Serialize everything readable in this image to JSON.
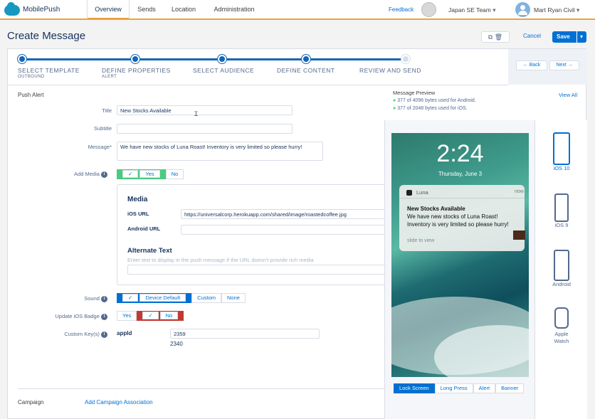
{
  "app": {
    "name": "MobilePush"
  },
  "nav": {
    "tabs": [
      "Overview",
      "Sends",
      "Location",
      "Administration"
    ],
    "feedback": "Feedback",
    "team": "Japan SE Team",
    "user": "Mart Ryan Civil"
  },
  "header": {
    "title": "Create Message",
    "cancel": "Cancel",
    "save": "Save"
  },
  "stepper": {
    "steps": [
      {
        "label": "SELECT TEMPLATE",
        "sub": "OUTBOUND"
      },
      {
        "label": "DEFINE PROPERTIES",
        "sub": "ALERT"
      },
      {
        "label": "SELECT AUDIENCE",
        "sub": ""
      },
      {
        "label": "DEFINE CONTENT",
        "sub": ""
      },
      {
        "label": "REVIEW AND SEND",
        "sub": ""
      }
    ],
    "back": "Back",
    "next": "Next"
  },
  "form": {
    "section": "Push Alert",
    "title_label": "Title",
    "title_value": "New Stocks Available",
    "subtitle_label": "Subtitle",
    "subtitle_value": "",
    "message_label": "Message*",
    "message_value": "We have new stocks of Luna Roast! Inventory is very limited so please hurry!",
    "add_media_label": "Add Media",
    "yes": "Yes",
    "no": "No",
    "media": {
      "heading": "Media",
      "ios_url_label": "iOS URL",
      "ios_url_value": "https://universalcorp.herokuapp.com/shared/image/roastedcoffee.jpg",
      "android_url_label": "Android URL",
      "android_url_value": "",
      "alt_heading": "Alternate Text",
      "alt_placeholder": "Enter text to display in the push message if the URL doesn't provide rich media"
    },
    "sound_label": "Sound",
    "sound_options": [
      "Device Default",
      "Custom",
      "None"
    ],
    "badge_label": "Update iOS Badge",
    "custom_keys_label": "Custom Key(s)",
    "custom_key_name": "appId",
    "custom_key_value": "2359",
    "custom_key_extra": "2340",
    "campaign_label": "Campaign",
    "campaign_link": "Add Campaign Association"
  },
  "preview": {
    "title": "Message Preview",
    "view_all": "View All",
    "android_bytes": "377 of 4096 bytes used for Android.",
    "ios_bytes": "377 of 2048 bytes used for iOS.",
    "time": "2:24",
    "date": "Thursday, June 3",
    "notif_app": "Luna",
    "notif_when": "now",
    "notif_title": "New Stocks Available",
    "notif_body": "We have new stocks of Luna Roast! Inventory is very limited so please hurry!",
    "notif_hint": "slide to view",
    "tabs": [
      "Lock Screen",
      "Long Press",
      "Alert",
      "Banner"
    ],
    "devices": [
      "iOS 10",
      "iOS 9",
      "Android",
      "Apple Watch"
    ]
  },
  "colors": {
    "accent": "#0070d2",
    "nav_underline": "#e8a33d",
    "success": "#4bca81",
    "danger": "#c23934"
  }
}
